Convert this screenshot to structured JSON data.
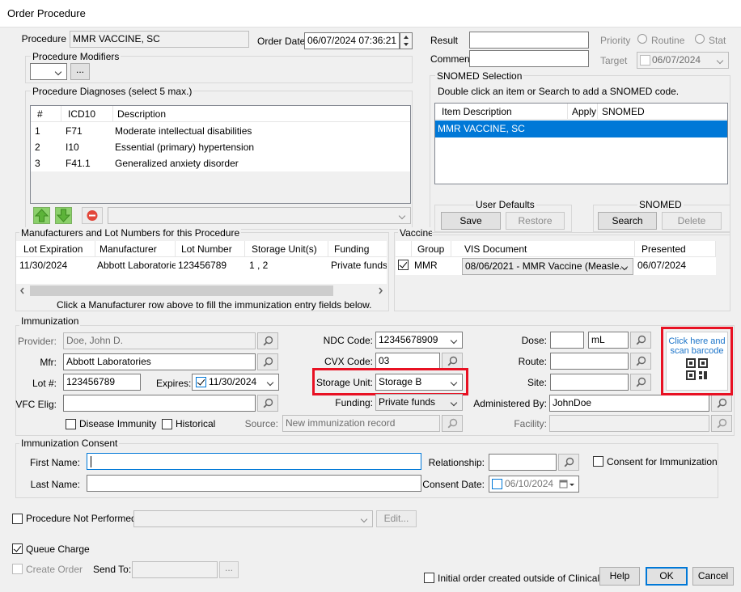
{
  "window": {
    "title": "Order Procedure"
  },
  "procedure": {
    "label": "Procedure",
    "value": "MMR VACCINE, SC",
    "order_date_label": "Order Date",
    "order_date": "06/07/2024 07:36:21",
    "modifiers_legend": "Procedure Modifiers",
    "modifier_more": "...",
    "diagnoses_legend": "Procedure Diagnoses (select 5 max.)",
    "diag_columns": [
      "#",
      "ICD10",
      "Description"
    ],
    "diagnoses": [
      {
        "num": "1",
        "icd": "F71",
        "desc": "Moderate intellectual disabilities"
      },
      {
        "num": "2",
        "icd": "I10",
        "desc": "Essential (primary) hypertension"
      },
      {
        "num": "3",
        "icd": "F41.1",
        "desc": "Generalized anxiety disorder"
      }
    ]
  },
  "result": {
    "result_label": "Result",
    "comment_label": "Comment",
    "priority_label": "Priority",
    "routine_label": "Routine",
    "stat_label": "Stat",
    "target_label": "Target",
    "target_date": "06/07/2024"
  },
  "snomed": {
    "legend": "SNOMED Selection",
    "hint": "Double click an item or Search to add a SNOMED code.",
    "columns": [
      "Item Description",
      "Apply",
      "SNOMED"
    ],
    "rows": [
      {
        "desc": "MMR VACCINE, SC",
        "apply": "",
        "code": ""
      }
    ],
    "user_defaults_label": "User Defaults",
    "save": "Save",
    "restore": "Restore",
    "snomed_label": "SNOMED",
    "search": "Search",
    "delete": "Delete"
  },
  "manufacturers": {
    "legend": "Manufacturers and Lot Numbers for this Procedure",
    "columns": [
      "Lot Expiration",
      "Manufacturer",
      "Lot Number",
      "Storage Unit(s)",
      "Funding"
    ],
    "rows": [
      {
        "exp": "11/30/2024",
        "mfr": "Abbott Laboratories",
        "lot": "123456789",
        "storage": "1 , 2",
        "funding": "Private funds"
      }
    ],
    "hint": "Click a Manufacturer row above to fill the immunization entry fields below."
  },
  "vaccine": {
    "legend": "Vaccine",
    "columns": [
      "Group",
      "VIS Document",
      "Presented"
    ],
    "rows": [
      {
        "group": "MMR",
        "vis": "08/06/2021 - MMR Vaccine (Measle...",
        "presented": "06/07/2024"
      }
    ]
  },
  "immunization": {
    "legend": "Immunization",
    "provider_label": "Provider:",
    "provider": "Doe, John D.",
    "mfr_label": "Mfr:",
    "mfr": "Abbott Laboratories",
    "lot_label": "Lot #:",
    "lot": "123456789",
    "expires_label": "Expires:",
    "expires": "11/30/2024",
    "vfc_label": "VFC Elig:",
    "vfc": "",
    "disease_immunity": "Disease Immunity",
    "historical": "Historical",
    "source_label": "Source:",
    "source": "New immunization record",
    "ndc_label": "NDC Code:",
    "ndc": "12345678909",
    "cvx_label": "CVX Code:",
    "cvx": "03",
    "storage_label": "Storage Unit:",
    "storage": "Storage B",
    "funding_label": "Funding:",
    "funding": "Private funds",
    "dose_label": "Dose:",
    "dose": "",
    "unit": "mL",
    "route_label": "Route:",
    "site_label": "Site:",
    "admin_label": "Administered By:",
    "admin": "JohnDoe",
    "facility_label": "Facility:",
    "barcode_text": "Click here and scan barcode"
  },
  "consent": {
    "legend": "Immunization Consent",
    "first_label": "First Name:",
    "last_label": "Last Name:",
    "relationship_label": "Relationship:",
    "consent_for": "Consent for Immunization",
    "consent_date_label": "Consent Date:",
    "consent_date": "06/10/2024"
  },
  "footer": {
    "not_performed": "Procedure Not Performed",
    "edit": "Edit...",
    "queue_charge": "Queue Charge",
    "create_order": "Create Order",
    "send_to_label": "Send To:",
    "send_more": "...",
    "initial_order": "Initial order created outside of Clinical",
    "help": "Help",
    "ok": "OK",
    "cancel": "Cancel"
  },
  "colors": {
    "selection": "#0078d7",
    "highlight": "#e81123",
    "link": "#1a73c9"
  }
}
